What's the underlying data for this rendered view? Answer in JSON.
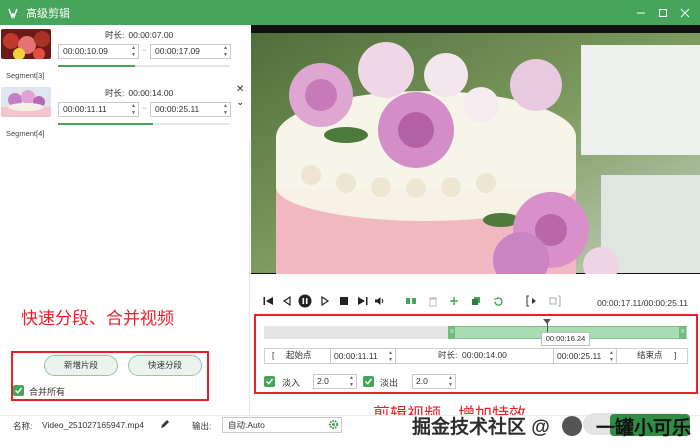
{
  "window": {
    "title": "高级剪辑"
  },
  "segments": [
    {
      "name": "Segment[3]",
      "duration_label": "时长:",
      "duration": "00:00:07.00",
      "start": "00:00:10.09",
      "end": "00:00:17.09",
      "progress": 0.45
    },
    {
      "name": "Segment[4]",
      "duration_label": "时长:",
      "duration": "00:00:14.00",
      "start": "00:00:11.11",
      "end": "00:00:25.11",
      "progress": 0.55
    }
  ],
  "left_actions": {
    "add_segment": "新增片段",
    "quick_split": "快速分段",
    "merge_all": "合并所有",
    "merge_all_checked": true
  },
  "annotations": {
    "left": "快速分段、合并视频",
    "right": "剪辑视频，增加特效"
  },
  "player": {
    "time_readout": "00:00:17.11/00:00:25.11"
  },
  "timeline": {
    "tooltip": "00:00:16.24",
    "selection_start_fraction": 0.44,
    "selection_end_fraction": 1.0,
    "playhead_fraction": 0.67
  },
  "trim": {
    "start_label": "起始点",
    "start_value": "00:00:11.11",
    "duration_label": "时长:",
    "duration_value": "00:00:14.00",
    "end_value": "00:00:25.11",
    "end_label": "结束点"
  },
  "fade": {
    "fade_in_label": "淡入",
    "fade_in_value": "2.0",
    "fade_out_label": "淡出",
    "fade_out_value": "2.0"
  },
  "bottom": {
    "name_label": "名称:",
    "file_name": "Video_251027165947.mp4",
    "output_label": "输出:",
    "output_value": "自动:Auto"
  },
  "watermark": {
    "text1": "掘金技术社区 @",
    "text2": "一罐小可乐"
  },
  "colors": {
    "accent": "#46a55a",
    "annotation_red": "#e8202a"
  }
}
